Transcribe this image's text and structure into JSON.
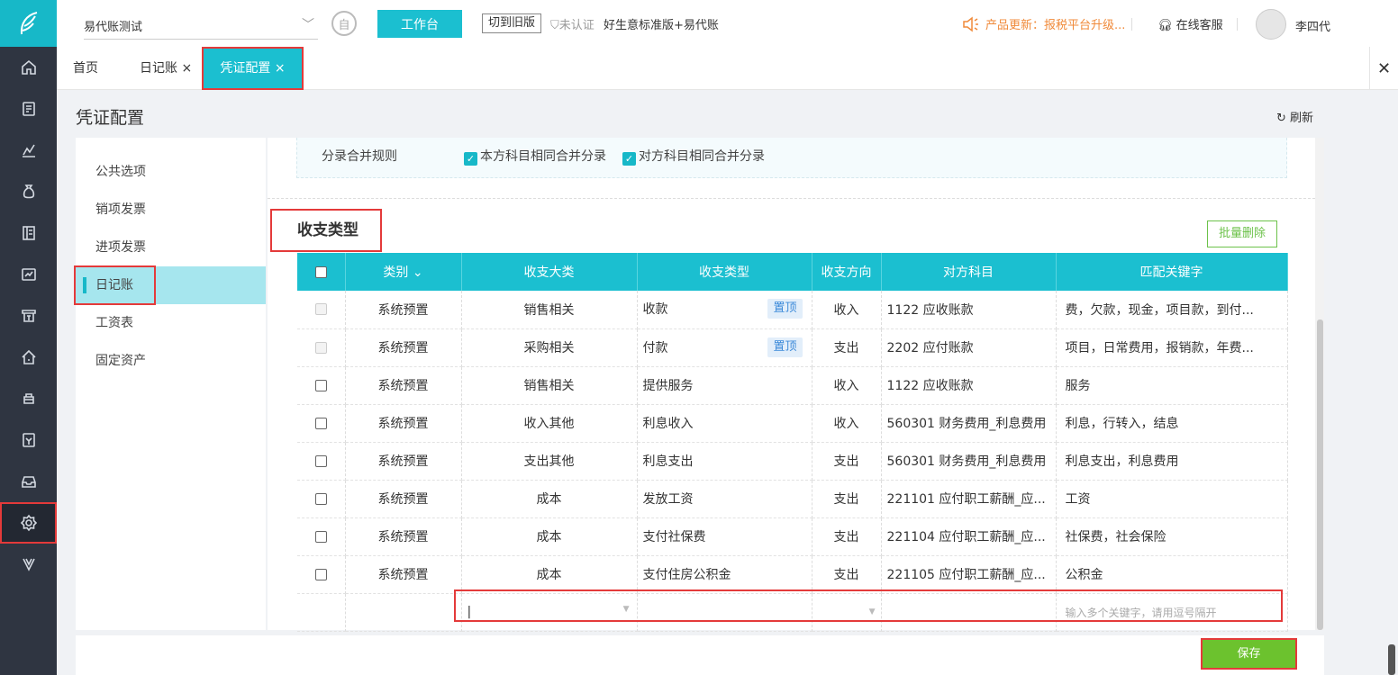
{
  "topbar": {
    "account_name": "易代账测试",
    "workbench_label": "工作台",
    "switch_old_label": "切到旧版",
    "unverified_label": "未认证",
    "edition_label": "好生意标准版+易代账",
    "update_label": "产品更新：报税平台升级...",
    "service_label": "在线客服",
    "user_name": "李四代"
  },
  "tabs": {
    "home": "首页",
    "journal": "日记账",
    "voucher_config": "凭证配置",
    "close_mark": "×"
  },
  "page": {
    "title": "凭证配置",
    "refresh_label": "刷新"
  },
  "left_menu": {
    "items": [
      "公共选项",
      "销项发票",
      "进项发票",
      "日记账",
      "工资表",
      "固定资产"
    ],
    "active_index": 3
  },
  "merge_rules": {
    "label": "分录合并规则",
    "option1": "本方科目相同合并分录",
    "option2": "对方科目相同合并分录",
    "option1_checked": true,
    "option2_checked": true
  },
  "section": {
    "title": "收支类型",
    "batch_delete_label": "批量删除"
  },
  "table": {
    "headers": [
      "类别",
      "收支大类",
      "收支类型",
      "收支方向",
      "对方科目",
      "匹配关键字"
    ],
    "pin_label": "置顶",
    "rows": [
      {
        "category": "系统预置",
        "major": "销售相关",
        "type": "收款",
        "pinned": true,
        "direction": "收入",
        "account": "1122 应收账款",
        "keywords": "费，欠款，现金，项目款，到付...",
        "disabled": true
      },
      {
        "category": "系统预置",
        "major": "采购相关",
        "type": "付款",
        "pinned": true,
        "direction": "支出",
        "account": "2202 应付账款",
        "keywords": "项目，日常费用，报销款，年费...",
        "disabled": true
      },
      {
        "category": "系统预置",
        "major": "销售相关",
        "type": "提供服务",
        "pinned": false,
        "direction": "收入",
        "account": "1122 应收账款",
        "keywords": "服务",
        "disabled": false
      },
      {
        "category": "系统预置",
        "major": "收入其他",
        "type": "利息收入",
        "pinned": false,
        "direction": "收入",
        "account": "560301 财务费用_利息费用",
        "keywords": "利息，行转入，结息",
        "disabled": false
      },
      {
        "category": "系统预置",
        "major": "支出其他",
        "type": "利息支出",
        "pinned": false,
        "direction": "支出",
        "account": "560301 财务费用_利息费用",
        "keywords": "利息支出，利息费用",
        "disabled": false
      },
      {
        "category": "系统预置",
        "major": "成本",
        "type": "发放工资",
        "pinned": false,
        "direction": "支出",
        "account": "221101 应付职工薪酬_应...",
        "keywords": "工资",
        "disabled": false
      },
      {
        "category": "系统预置",
        "major": "成本",
        "type": "支付社保费",
        "pinned": false,
        "direction": "支出",
        "account": "221104 应付职工薪酬_应...",
        "keywords": "社保费，社会保险",
        "disabled": false
      },
      {
        "category": "系统预置",
        "major": "成本",
        "type": "支付住房公积金",
        "pinned": false,
        "direction": "支出",
        "account": "221105 应付职工薪酬_应...",
        "keywords": "公积金",
        "disabled": false
      }
    ],
    "new_row": {
      "keywords_placeholder": "输入多个关键字，请用逗号隔开"
    }
  },
  "footer": {
    "save_label": "保存"
  },
  "colors": {
    "accent": "#1bbfd0",
    "sidebar": "#2f3541",
    "save": "#6cc22e",
    "highlight": "#e43a3a",
    "update": "#f08a3a"
  }
}
